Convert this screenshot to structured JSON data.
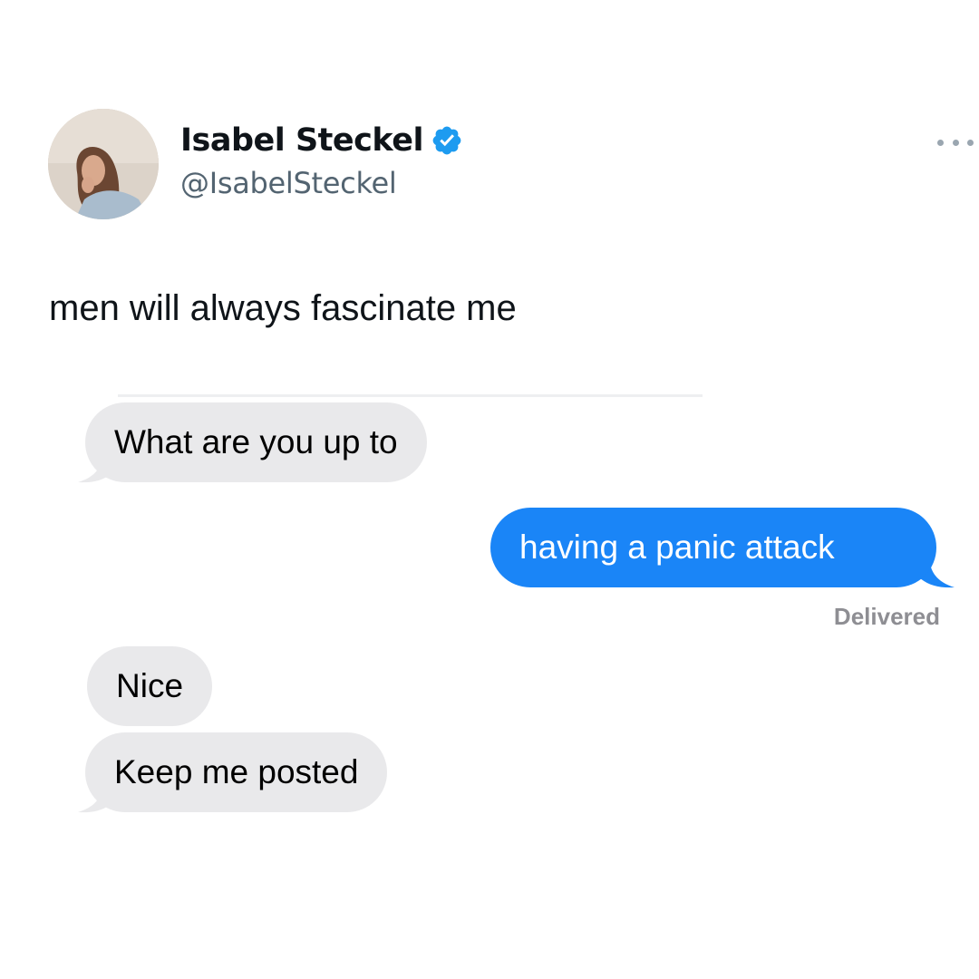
{
  "tweet": {
    "author_name": "Isabel Steckel",
    "author_handle": "@IsabelSteckel",
    "verified": true,
    "text": "men will always fascinate me"
  },
  "messages": [
    {
      "direction": "received",
      "text": "What are you up to"
    },
    {
      "direction": "sent",
      "text": "having a panic attack",
      "status": "Delivered"
    },
    {
      "direction": "received",
      "text": "Nice"
    },
    {
      "direction": "received",
      "text": "Keep me posted"
    }
  ],
  "icons": {
    "verified": "verified-badge-icon",
    "more": "more-options-icon"
  },
  "colors": {
    "verified_blue": "#1d9bf0",
    "sent_bubble": "#1a85f7",
    "received_bubble": "#e9e9eb",
    "handle_gray": "#536471",
    "status_gray": "#8e8e93"
  }
}
